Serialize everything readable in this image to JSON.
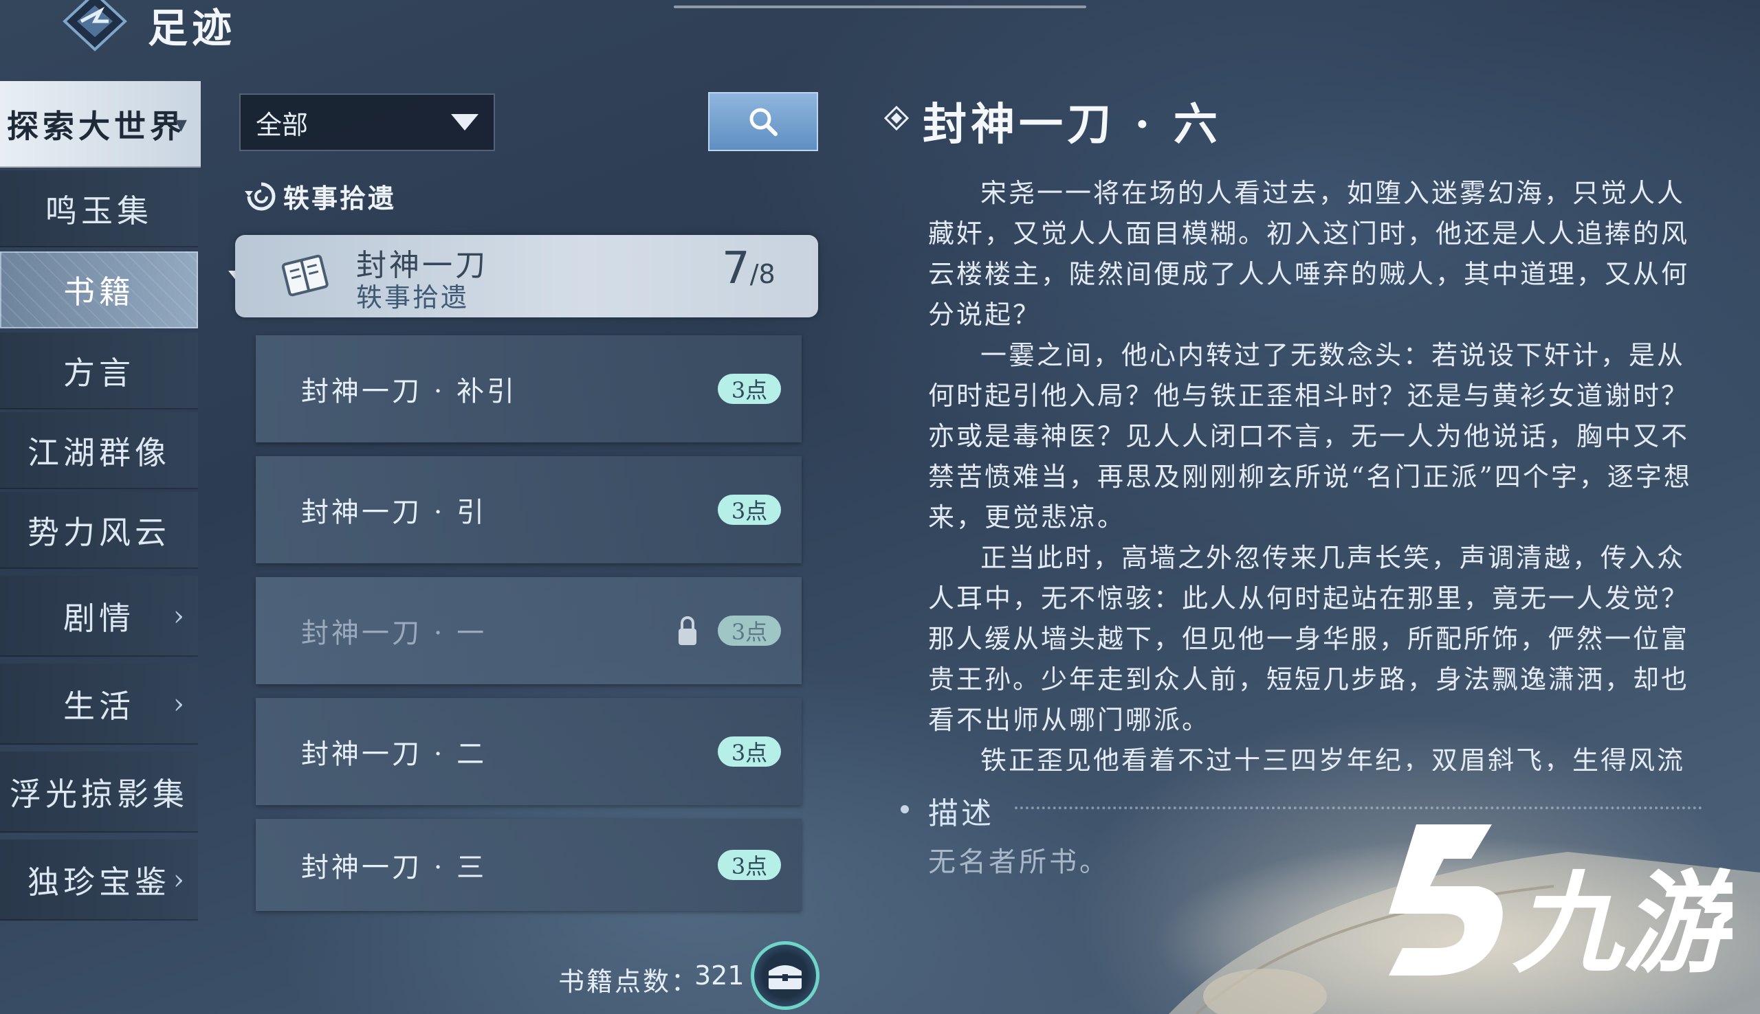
{
  "header": {
    "title": "足迹"
  },
  "sidebar": {
    "items": [
      {
        "label": "探索大世界",
        "chevron": "▾"
      },
      {
        "label": "鸣玉集"
      },
      {
        "label": "书籍"
      },
      {
        "label": "方言"
      },
      {
        "label": "江湖群像"
      },
      {
        "label": "势力风云"
      },
      {
        "label": "剧情",
        "chevron": "›"
      },
      {
        "label": "生活",
        "chevron": "›"
      },
      {
        "label": "浮光掠影集",
        "chevron": "›"
      },
      {
        "label": "独珍宝鉴",
        "chevron": "›"
      }
    ]
  },
  "filter": {
    "selected": "全部"
  },
  "group": {
    "label": "轶事拾遗"
  },
  "category": {
    "title": "封神一刀",
    "subtitle": "轶事拾遗",
    "progress_current": "7",
    "progress_total": "/8"
  },
  "entries": [
    {
      "label": "封神一刀 · 补引",
      "badge": "3点",
      "locked": false
    },
    {
      "label": "封神一刀 · 引",
      "badge": "3点",
      "locked": false
    },
    {
      "label": "封神一刀 · 一",
      "badge": "3点",
      "locked": true
    },
    {
      "label": "封神一刀 · 二",
      "badge": "3点",
      "locked": false
    },
    {
      "label": "封神一刀 · 三",
      "badge": "3点",
      "locked": false
    }
  ],
  "footer": {
    "points_label": "书籍点数：",
    "points_value": "321"
  },
  "detail": {
    "title": "封神一刀 · 六",
    "paragraphs": [
      "宋尧一一将在场的人看过去，如堕入迷雾幻海，只觉人人藏奸，又觉人人面目模糊。初入这门时，他还是人人追捧的风云楼楼主，陡然间便成了人人唾弃的贼人，其中道理，又从何分说起？",
      "一霎之间，他心内转过了无数念头：若说设下奸计，是从何时起引他入局？他与铁正歪相斗时？还是与黄衫女道谢时？亦或是毒神医？见人人闭口不言，无一人为他说话，胸中又不禁苦愤难当，再思及刚刚柳玄所说“名门正派”四个字，逐字想来，更觉悲凉。",
      "正当此时，高墙之外忽传来几声长笑，声调清越，传入众人耳中，无不惊骇：此人从何时起站在那里，竟无一人发觉？那人缓从墙头越下，但见他一身华服，所配所饰，俨然一位富贵王孙。少年走到众人前，短短几步路，身法飘逸潇洒，却也看不出师从哪门哪派。",
      "铁正歪见他看着不过十三四岁年纪，双眉斜飞，生得风流"
    ],
    "desc_heading": "描述",
    "desc_text": "无名者所书。"
  },
  "icons": {
    "logo": "diamond-emblem-icon",
    "search": "search-icon",
    "group": "swirl-icon",
    "book": "book-icon",
    "lock": "lock-icon",
    "chest": "chest-icon",
    "marker": "diamond-marker-icon"
  },
  "colors": {
    "badge": "#b6efe7",
    "accent_ring": "#6ed5c8",
    "search_btn": "#7aa6d3"
  },
  "watermark": {
    "text": "九游"
  }
}
